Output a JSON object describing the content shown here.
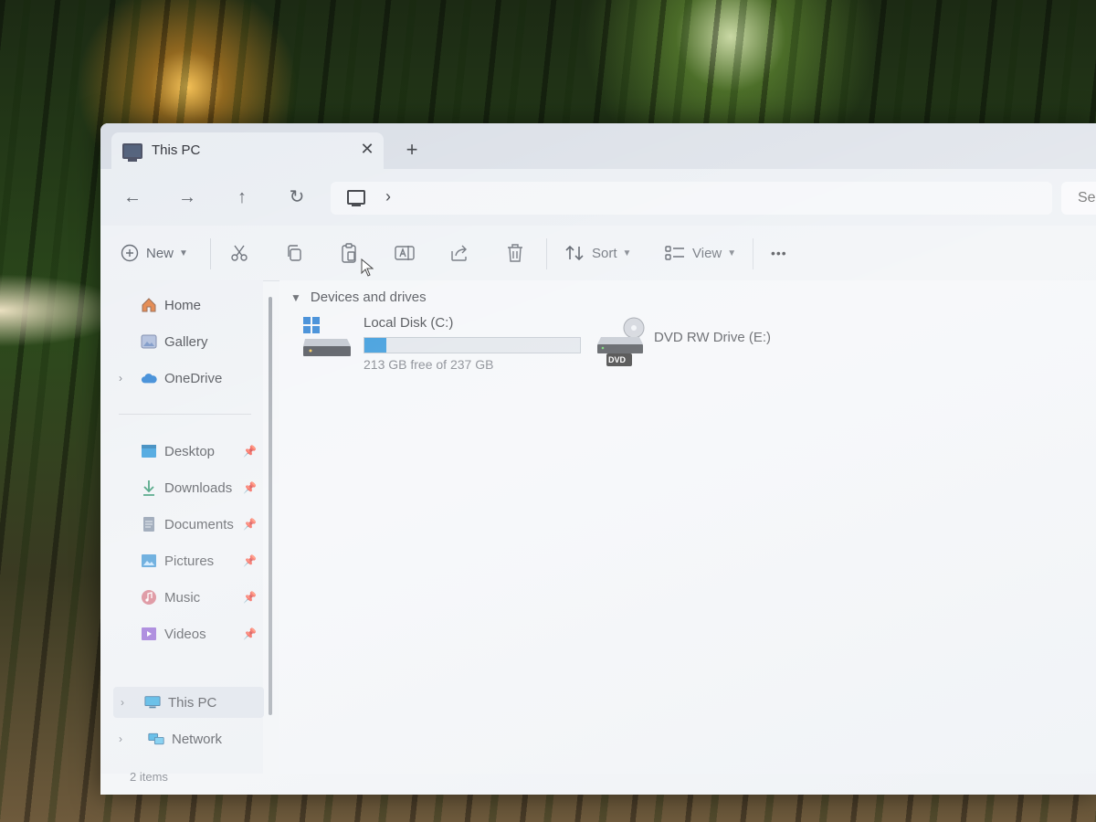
{
  "tab": {
    "title": "This PC",
    "close": "✕",
    "new_tab": "+"
  },
  "nav": {
    "back": "←",
    "forward": "→",
    "up": "↑",
    "refresh": "↻",
    "chevron": "›"
  },
  "search": {
    "text": "Sea"
  },
  "commands": {
    "new_label": "New",
    "sort_label": "Sort",
    "view_label": "View",
    "more": "•••"
  },
  "sidebar": {
    "items": [
      {
        "label": "Home",
        "icon": "home-icon"
      },
      {
        "label": "Gallery",
        "icon": "gallery-icon"
      },
      {
        "label": "OneDrive",
        "icon": "cloud-icon"
      },
      {
        "label": "Desktop",
        "icon": "desktop-folder-icon"
      },
      {
        "label": "Downloads",
        "icon": "download-icon"
      },
      {
        "label": "Documents",
        "icon": "documents-icon"
      },
      {
        "label": "Pictures",
        "icon": "pictures-icon"
      },
      {
        "label": "Music",
        "icon": "music-icon"
      },
      {
        "label": "Videos",
        "icon": "videos-icon"
      },
      {
        "label": "This PC",
        "icon": "computer-icon"
      },
      {
        "label": "Network",
        "icon": "network-icon"
      }
    ]
  },
  "content": {
    "group_title": "Devices and drives",
    "drives": [
      {
        "name": "Local Disk (C:)",
        "free_text": "213 GB free of 237 GB",
        "used_fraction": 0.101
      },
      {
        "name": "DVD RW Drive (E:)",
        "badge": "DVD"
      }
    ]
  },
  "status": {
    "item_count": "2 items"
  },
  "colors": {
    "accent": "#1a8ad6",
    "folder_blue": "#1e90d8"
  }
}
